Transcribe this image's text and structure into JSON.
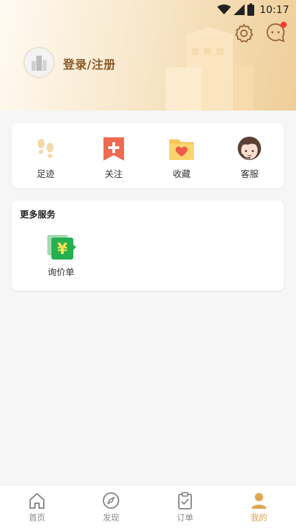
{
  "status_bar": {
    "time": "10:17"
  },
  "header": {
    "login_label": "登录/注册",
    "icons": [
      "settings-icon",
      "message-icon"
    ],
    "notification_dot_color": "#ff3b30"
  },
  "quick_actions": [
    {
      "label": "足迹",
      "icon": "footprints-icon"
    },
    {
      "label": "关注",
      "icon": "bookmark-plus-icon"
    },
    {
      "label": "收藏",
      "icon": "heart-folder-icon"
    },
    {
      "label": "客服",
      "icon": "customer-service-icon"
    }
  ],
  "services": {
    "title": "更多服务",
    "items": [
      {
        "label": "询价单",
        "icon": "price-inquiry-icon"
      }
    ]
  },
  "tabbar": {
    "active": "我的",
    "accent_color": "#d9a04b",
    "tabs": [
      {
        "label": "首页",
        "icon": "home-icon"
      },
      {
        "label": "发现",
        "icon": "compass-icon"
      },
      {
        "label": "订单",
        "icon": "clipboard-icon"
      },
      {
        "label": "我的",
        "icon": "profile-icon"
      }
    ]
  }
}
